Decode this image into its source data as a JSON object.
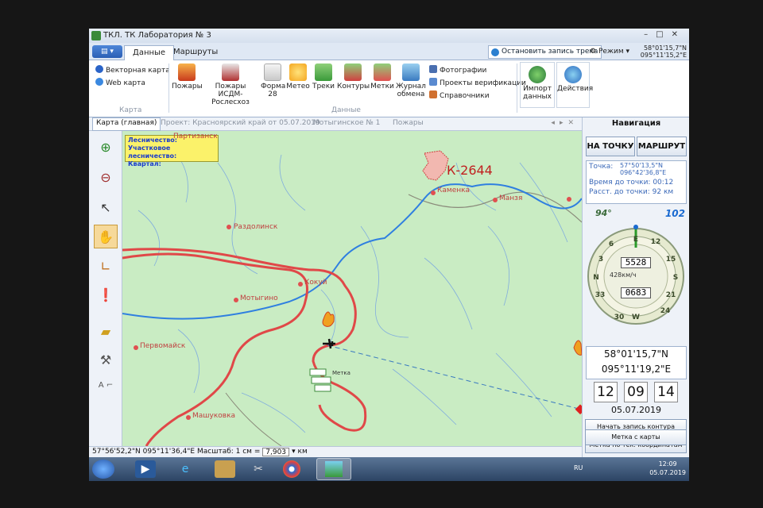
{
  "window": {
    "title": "ТКЛ. ТК Лаборатория № 3"
  },
  "ribbon_tabs": [
    {
      "label": "Данные"
    },
    {
      "label": "Маршруты"
    }
  ],
  "header": {
    "record_label": "Остановить запись трека",
    "mode_label": "Режим",
    "coord_lat": "58°01'15,7\"N",
    "coord_lon": "095°11'15,2\"E"
  },
  "ribbon": {
    "map_group": {
      "vector_map": "Векторная карта",
      "web_map": "Web карта",
      "label": "Карта"
    },
    "data_items": [
      {
        "label": "Пожары"
      },
      {
        "label": "Пожары ИСДМ-Рослесхоз"
      },
      {
        "label": "Форма 28"
      },
      {
        "label": "Метео"
      },
      {
        "label": "Треки"
      },
      {
        "label": "Контуры"
      },
      {
        "label": "Метки"
      },
      {
        "label": "Журнал обмена"
      }
    ],
    "side_items": [
      {
        "label": "Фотографии"
      },
      {
        "label": "Проекты верификации"
      },
      {
        "label": "Справочники"
      }
    ],
    "data_group_label": "Данные",
    "import_label": "Импорт данных",
    "actions_label": "Действия"
  },
  "doc_tabs": [
    {
      "label": "Карта (главная)"
    },
    {
      "label": "Проект: Красноярский край от 05.07.2019"
    },
    {
      "label": "Мотыгинское № 1"
    },
    {
      "label": "Пожары"
    }
  ],
  "map": {
    "infobox": {
      "l1": "Лесничество:",
      "l2": "Участковое лесничество:",
      "l3": "Квартал:"
    },
    "places": {
      "parizansk": "Партизанск",
      "razdolinsk": "Раздолинск",
      "kamenka": "Каменка",
      "manzya": "Манзя",
      "kokui": "Кокуй",
      "motygino": "Мотыгино",
      "pervomaysk": "Первомайск",
      "mashukovka": "Машуковка"
    },
    "fire_label": "К-2644",
    "mark_label": "Метка"
  },
  "status": {
    "coords": "57°56'52,2\"N 095°11'36,4\"E  Масштаб: 1 см =",
    "scale": "7,903",
    "unit": "км"
  },
  "nav": {
    "title": "Навигация",
    "to_point": "НА ТОЧКУ",
    "route": "МАРШРУТ",
    "point_label": "Точка:",
    "point_lat": "57°50'13,5\"N",
    "point_lon": "096°42'36,8\"E",
    "time_to_point": "Время до точки: 00:12",
    "dist_to_point": "Расст. до точки: 92 км",
    "bearing": "94°",
    "heading": "102",
    "alt": "5528",
    "speed": "428км/ч",
    "dist": "0683",
    "lat": "58°01'15,7\"N",
    "lon": "095°11'19,2\"E",
    "hh": "12",
    "mm": "09",
    "ss": "14",
    "date": "05.07.2019",
    "btn_start": "Начать запись контура",
    "btn_mark_cur": "Метка по тек. координатам",
    "btn_mark_map": "Метка с карты"
  },
  "taskbar": {
    "lang": "RU",
    "time": "12:09",
    "date": "05.07.2019"
  }
}
